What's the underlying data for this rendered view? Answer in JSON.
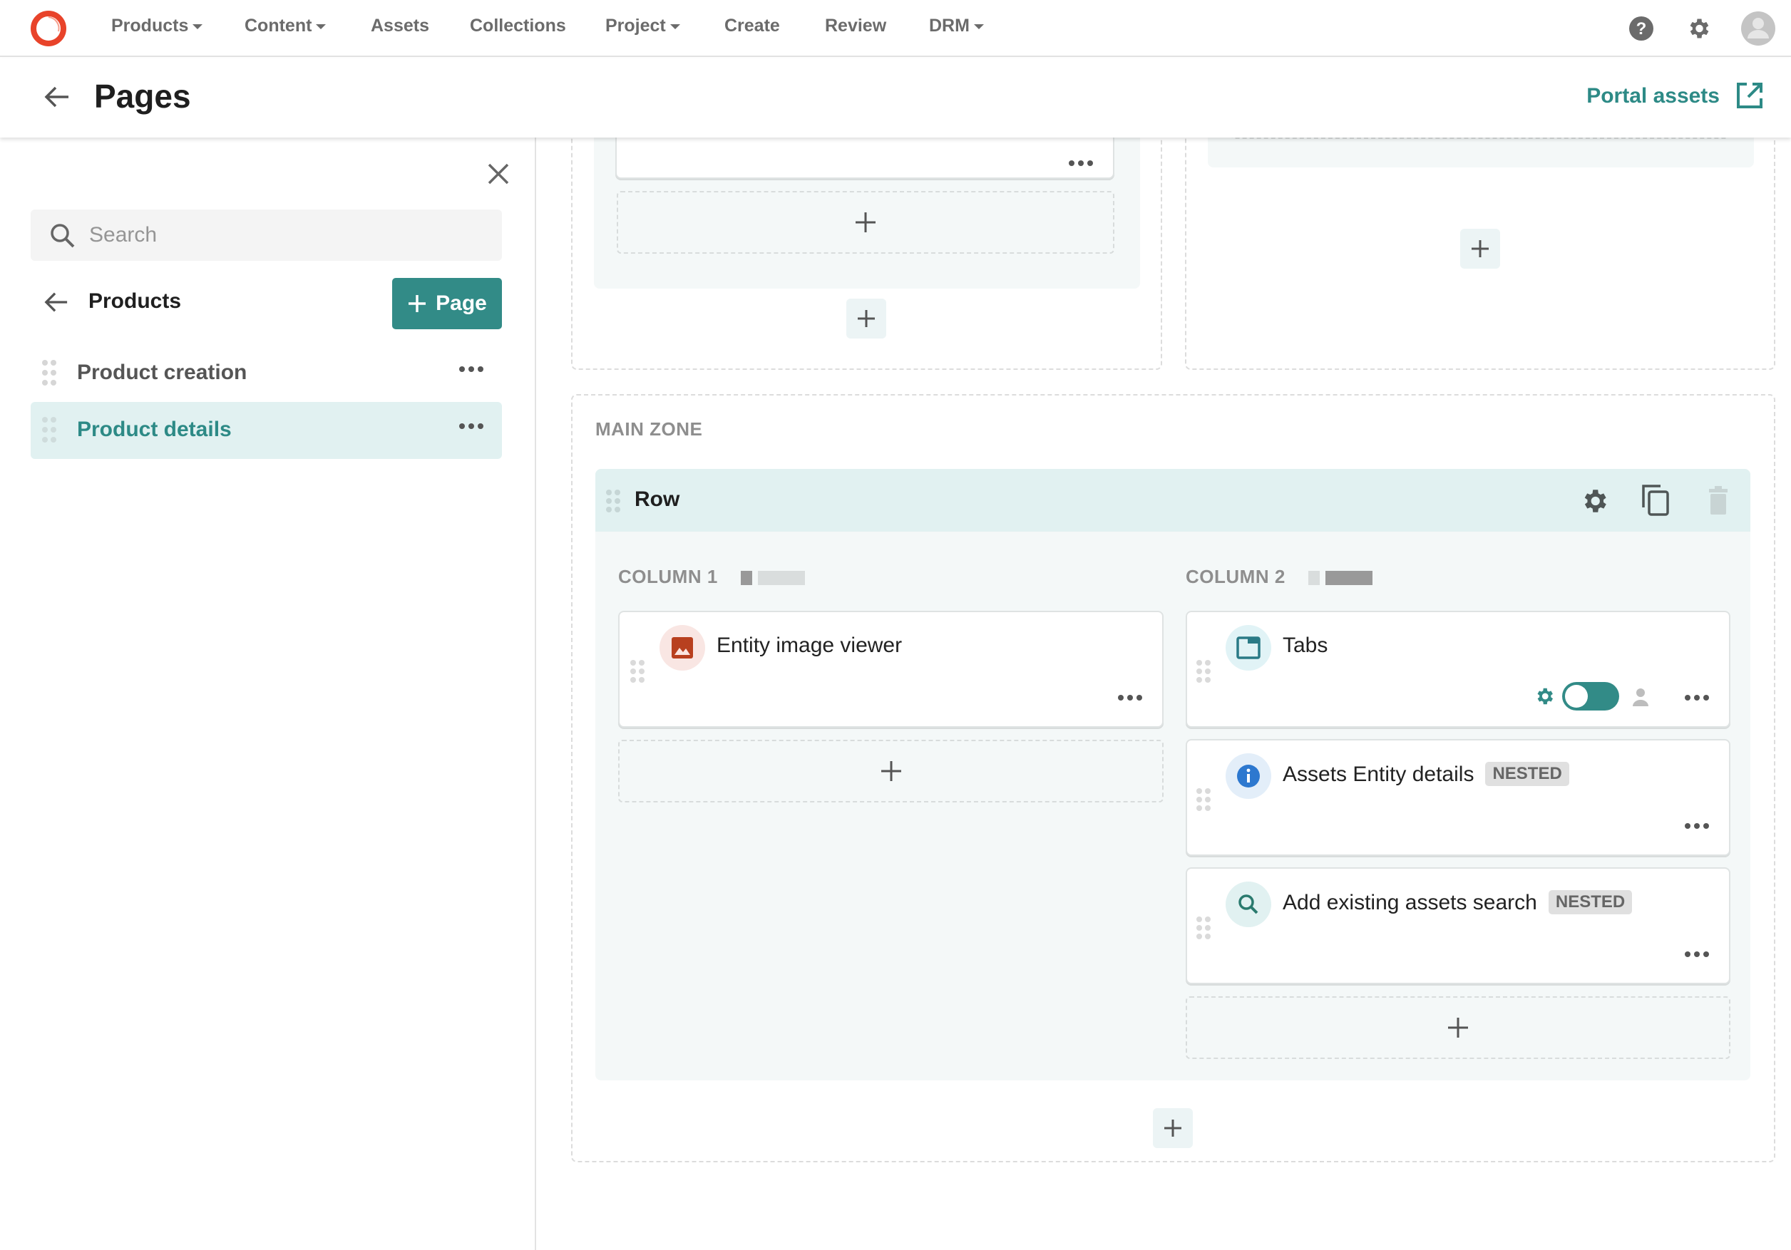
{
  "topnav": {
    "items": [
      {
        "label": "Products",
        "dropdown": true
      },
      {
        "label": "Content",
        "dropdown": true
      },
      {
        "label": "Assets",
        "dropdown": false
      },
      {
        "label": "Collections",
        "dropdown": false
      },
      {
        "label": "Project",
        "dropdown": true
      },
      {
        "label": "Create",
        "dropdown": false
      },
      {
        "label": "Review",
        "dropdown": false
      },
      {
        "label": "DRM",
        "dropdown": true
      }
    ],
    "icons": [
      "help-icon",
      "settings-icon",
      "user-avatar-icon"
    ]
  },
  "page_header": {
    "title": "Pages",
    "portal_link": "Portal assets"
  },
  "sidebar": {
    "search_placeholder": "Search",
    "parent_label": "Products",
    "add_page_label": "Page",
    "pages": [
      {
        "label": "Product creation",
        "active": false
      },
      {
        "label": "Product details",
        "active": true
      }
    ]
  },
  "canvas": {
    "main_zone_label": "MAIN ZONE",
    "row": {
      "label": "Row",
      "actions": [
        "settings-icon",
        "duplicate-icon",
        "delete-icon"
      ],
      "columns": [
        {
          "label": "COLUMN 1",
          "width_indicator": "narrow",
          "widgets": [
            {
              "title": "Entity image viewer",
              "icon": "image-icon",
              "nested": false
            }
          ]
        },
        {
          "label": "COLUMN 2",
          "width_indicator": "wide",
          "widgets": [
            {
              "title": "Tabs",
              "icon": "tabs-icon",
              "nested": false,
              "toggle_on": true
            },
            {
              "title": "Assets Entity details",
              "icon": "info-icon",
              "nested": true,
              "badge": "NESTED"
            },
            {
              "title": "Add existing assets search",
              "icon": "search-icon",
              "nested": true,
              "badge": "NESTED"
            }
          ]
        }
      ]
    }
  },
  "colors": {
    "accent": "#328b87",
    "accent_text": "#2d8a86",
    "active_bg": "#e1f1f1",
    "logo": "#e8432a",
    "image_icon": "#b8401f",
    "info_icon": "#2d78cf"
  }
}
